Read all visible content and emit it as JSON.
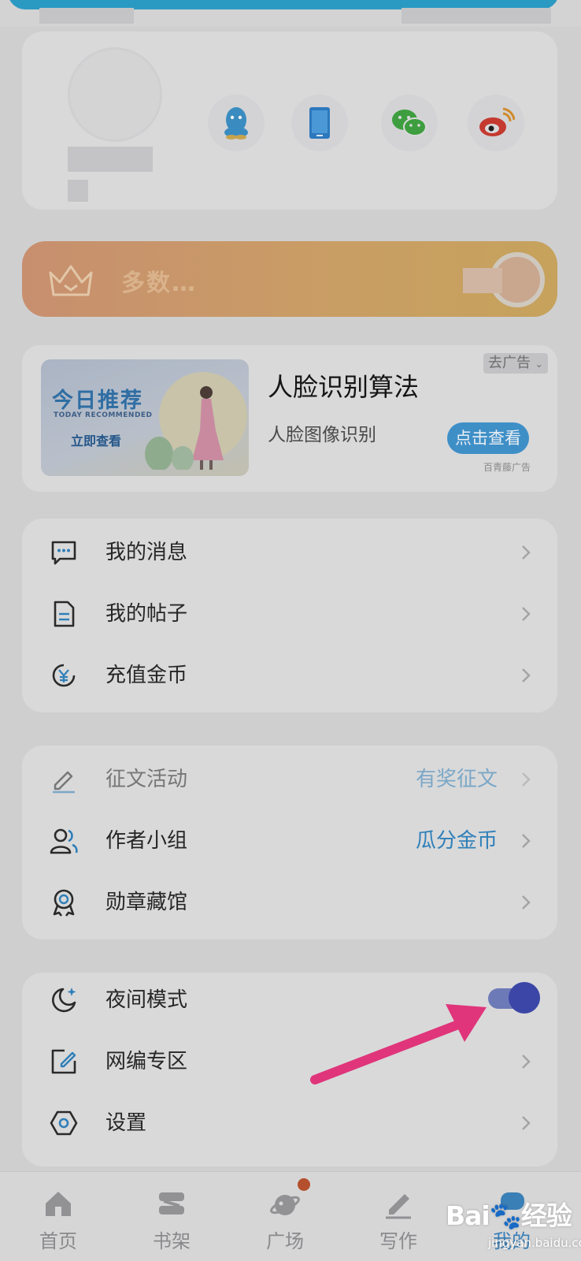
{
  "profile": {
    "social_icons": [
      "qq-icon",
      "phone-icon",
      "wechat-icon",
      "weibo-icon"
    ]
  },
  "vip_banner": {
    "text": "多数…"
  },
  "ad": {
    "image_title": "今日推荐",
    "image_subtitle": "TODAY RECOMMENDED",
    "image_cta": "立即查看",
    "headline": "人脸识别算法",
    "subtitle": "人脸图像识别",
    "remove_label": "去广告",
    "view_button": "点击查看",
    "source": "百青藤广告"
  },
  "menu_group_1": [
    {
      "label": "我的消息",
      "icon": "message-icon"
    },
    {
      "label": "我的帖子",
      "icon": "document-icon"
    },
    {
      "label": "充值金币",
      "icon": "coin-icon"
    }
  ],
  "menu_group_2": [
    {
      "label": "征文活动",
      "icon": "pen-icon",
      "right": "有奖征文"
    },
    {
      "label": "作者小组",
      "icon": "group-icon",
      "right": "瓜分金币"
    },
    {
      "label": "勋章藏馆",
      "icon": "medal-icon"
    }
  ],
  "menu_group_3": [
    {
      "label": "夜间模式",
      "icon": "moon-icon",
      "toggle_on": true
    },
    {
      "label": "网编专区",
      "icon": "edit-icon"
    },
    {
      "label": "设置",
      "icon": "settings-icon"
    }
  ],
  "bottom_nav": [
    {
      "label": "首页",
      "icon": "home-icon"
    },
    {
      "label": "书架",
      "icon": "bookshelf-icon"
    },
    {
      "label": "广场",
      "icon": "planet-icon"
    },
    {
      "label": "写作",
      "icon": "write-icon"
    },
    {
      "label": "我的",
      "icon": "profile-icon"
    }
  ],
  "watermark": {
    "logo": "Bai🐾经验",
    "url": "jingyan.baidu.com"
  },
  "colors": {
    "accent_blue": "#2f7fb8",
    "toggle": "#3b46a6",
    "arrow": "#e0357a"
  }
}
